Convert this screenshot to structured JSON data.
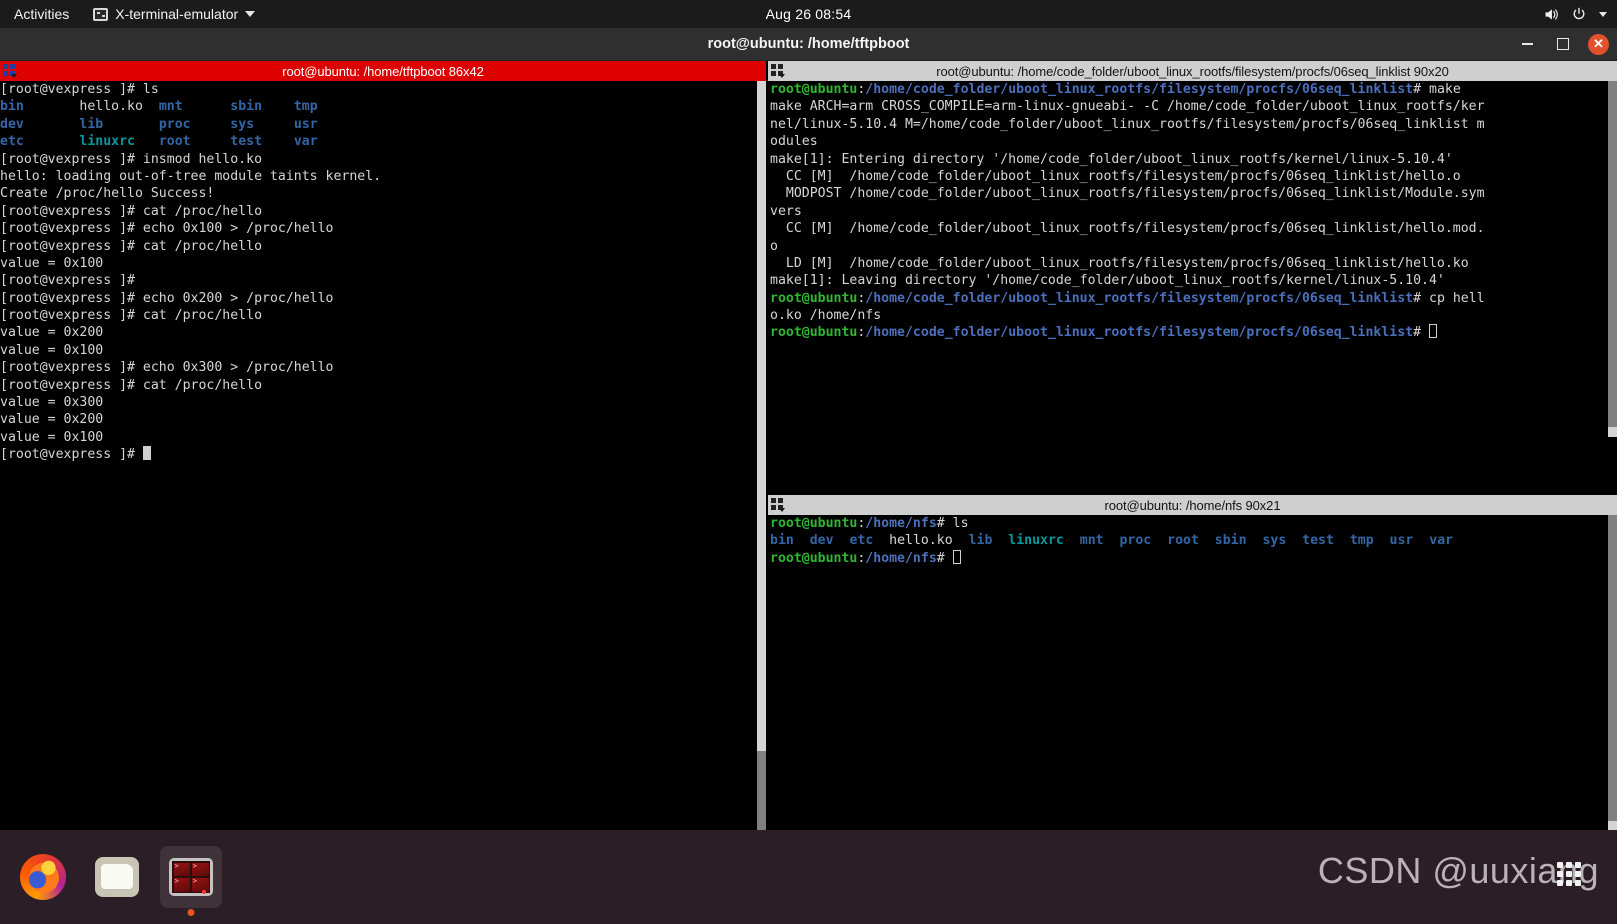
{
  "topbar": {
    "activities": "Activities",
    "app_menu": "X-terminal-emulator",
    "clock": "Aug 26  08:54",
    "icons": {
      "app": "terminal-icon",
      "caret": "chevron-down-icon",
      "volume": "volume-icon",
      "power": "power-icon",
      "arrow": "chevron-down-icon"
    }
  },
  "window": {
    "title": "root@ubuntu: /home/tftpboot",
    "minimize_label": "–",
    "maximize_label": "▢",
    "close_label": "✕"
  },
  "panes": {
    "left": {
      "title": "root@ubuntu: /home/tftpboot 86x42",
      "active": true,
      "lines": [
        [
          {
            "t": "[root@vexpress ]# ls",
            "c": "c-white"
          }
        ],
        [
          {
            "t": "bin",
            "c": "c-blue"
          },
          {
            "t": "       ",
            "c": "c-white"
          },
          {
            "t": "hello.ko",
            "c": "c-white"
          },
          {
            "t": "  ",
            "c": "c-white"
          },
          {
            "t": "mnt",
            "c": "c-blue"
          },
          {
            "t": "      ",
            "c": "c-white"
          },
          {
            "t": "sbin",
            "c": "c-blue"
          },
          {
            "t": "    ",
            "c": "c-white"
          },
          {
            "t": "tmp",
            "c": "c-blue"
          }
        ],
        [
          {
            "t": "dev",
            "c": "c-blue"
          },
          {
            "t": "       ",
            "c": "c-white"
          },
          {
            "t": "lib",
            "c": "c-blue"
          },
          {
            "t": "       ",
            "c": "c-white"
          },
          {
            "t": "proc",
            "c": "c-blue"
          },
          {
            "t": "     ",
            "c": "c-white"
          },
          {
            "t": "sys",
            "c": "c-blue"
          },
          {
            "t": "     ",
            "c": "c-white"
          },
          {
            "t": "usr",
            "c": "c-blue"
          }
        ],
        [
          {
            "t": "etc",
            "c": "c-blue"
          },
          {
            "t": "       ",
            "c": "c-white"
          },
          {
            "t": "linuxrc",
            "c": "c-cyan"
          },
          {
            "t": "   ",
            "c": "c-white"
          },
          {
            "t": "root",
            "c": "c-blue"
          },
          {
            "t": "     ",
            "c": "c-white"
          },
          {
            "t": "test",
            "c": "c-blue"
          },
          {
            "t": "    ",
            "c": "c-white"
          },
          {
            "t": "var",
            "c": "c-blue"
          }
        ],
        [
          {
            "t": "[root@vexpress ]# insmod hello.ko",
            "c": "c-white"
          }
        ],
        [
          {
            "t": "hello: loading out-of-tree module taints kernel.",
            "c": "c-white"
          }
        ],
        [
          {
            "t": "Create /proc/hello Success!",
            "c": "c-white"
          }
        ],
        [
          {
            "t": "[root@vexpress ]# cat /proc/hello",
            "c": "c-white"
          }
        ],
        [
          {
            "t": "[root@vexpress ]# echo 0x100 > /proc/hello",
            "c": "c-white"
          }
        ],
        [
          {
            "t": "[root@vexpress ]# cat /proc/hello",
            "c": "c-white"
          }
        ],
        [
          {
            "t": "value = 0x100",
            "c": "c-white"
          }
        ],
        [
          {
            "t": "[root@vexpress ]#",
            "c": "c-white"
          }
        ],
        [
          {
            "t": "[root@vexpress ]# echo 0x200 > /proc/hello",
            "c": "c-white"
          }
        ],
        [
          {
            "t": "[root@vexpress ]# cat /proc/hello",
            "c": "c-white"
          }
        ],
        [
          {
            "t": "value = 0x200",
            "c": "c-white"
          }
        ],
        [
          {
            "t": "value = 0x100",
            "c": "c-white"
          }
        ],
        [
          {
            "t": "[root@vexpress ]# echo 0x300 > /proc/hello",
            "c": "c-white"
          }
        ],
        [
          {
            "t": "[root@vexpress ]# cat /proc/hello",
            "c": "c-white"
          }
        ],
        [
          {
            "t": "value = 0x300",
            "c": "c-white"
          }
        ],
        [
          {
            "t": "value = 0x200",
            "c": "c-white"
          }
        ],
        [
          {
            "t": "value = 0x100",
            "c": "c-white"
          }
        ],
        [
          {
            "t": "[root@vexpress ]# ",
            "c": "c-white",
            "cursor": "block"
          }
        ]
      ]
    },
    "right_top": {
      "title": "root@ubuntu: /home/code_folder/uboot_linux_rootfs/filesystem/procfs/06seq_linklist 90x20",
      "active": false,
      "lines": [
        [
          {
            "t": "root@ubuntu",
            "c": "c-green"
          },
          {
            "t": ":",
            "c": "c-white"
          },
          {
            "t": "/home/code_folder/uboot_linux_rootfs/filesystem/procfs/06seq_linklist",
            "c": "c-blue2"
          },
          {
            "t": "# make",
            "c": "c-white"
          }
        ],
        [
          {
            "t": "make ARCH=arm CROSS_COMPILE=arm-linux-gnueabi- -C /home/code_folder/uboot_linux_rootfs/ker",
            "c": "c-white"
          }
        ],
        [
          {
            "t": "nel/linux-5.10.4 M=/home/code_folder/uboot_linux_rootfs/filesystem/procfs/06seq_linklist m",
            "c": "c-white"
          }
        ],
        [
          {
            "t": "odules",
            "c": "c-white"
          }
        ],
        [
          {
            "t": "make[1]: Entering directory '/home/code_folder/uboot_linux_rootfs/kernel/linux-5.10.4'",
            "c": "c-white"
          }
        ],
        [
          {
            "t": "  CC [M]  /home/code_folder/uboot_linux_rootfs/filesystem/procfs/06seq_linklist/hello.o",
            "c": "c-white"
          }
        ],
        [
          {
            "t": "  MODPOST /home/code_folder/uboot_linux_rootfs/filesystem/procfs/06seq_linklist/Module.sym",
            "c": "c-white"
          }
        ],
        [
          {
            "t": "vers",
            "c": "c-white"
          }
        ],
        [
          {
            "t": "  CC [M]  /home/code_folder/uboot_linux_rootfs/filesystem/procfs/06seq_linklist/hello.mod.",
            "c": "c-white"
          }
        ],
        [
          {
            "t": "o",
            "c": "c-white"
          }
        ],
        [
          {
            "t": "  LD [M]  /home/code_folder/uboot_linux_rootfs/filesystem/procfs/06seq_linklist/hello.ko",
            "c": "c-white"
          }
        ],
        [
          {
            "t": "make[1]: Leaving directory '/home/code_folder/uboot_linux_rootfs/kernel/linux-5.10.4'",
            "c": "c-white"
          }
        ],
        [
          {
            "t": "root@ubuntu",
            "c": "c-green"
          },
          {
            "t": ":",
            "c": "c-white"
          },
          {
            "t": "/home/code_folder/uboot_linux_rootfs/filesystem/procfs/06seq_linklist",
            "c": "c-blue2"
          },
          {
            "t": "# cp hell",
            "c": "c-white"
          }
        ],
        [
          {
            "t": "o.ko /home/nfs",
            "c": "c-white"
          }
        ],
        [
          {
            "t": "root@ubuntu",
            "c": "c-green"
          },
          {
            "t": ":",
            "c": "c-white"
          },
          {
            "t": "/home/code_folder/uboot_linux_rootfs/filesystem/procfs/06seq_linklist",
            "c": "c-blue2"
          },
          {
            "t": "# ",
            "c": "c-white",
            "cursor": "hollow"
          }
        ]
      ]
    },
    "right_bottom": {
      "title": "root@ubuntu: /home/nfs 90x21",
      "active": false,
      "lines": [
        [
          {
            "t": "root@ubuntu",
            "c": "c-green"
          },
          {
            "t": ":",
            "c": "c-white"
          },
          {
            "t": "/home/nfs",
            "c": "c-blue2"
          },
          {
            "t": "# ls",
            "c": "c-white"
          }
        ],
        [
          {
            "t": "bin",
            "c": "c-blue"
          },
          {
            "t": "  ",
            "c": "c-white"
          },
          {
            "t": "dev",
            "c": "c-blue"
          },
          {
            "t": "  ",
            "c": "c-white"
          },
          {
            "t": "etc",
            "c": "c-blue"
          },
          {
            "t": "  ",
            "c": "c-white"
          },
          {
            "t": "hello.ko",
            "c": "c-white"
          },
          {
            "t": "  ",
            "c": "c-white"
          },
          {
            "t": "lib",
            "c": "c-blue"
          },
          {
            "t": "  ",
            "c": "c-white"
          },
          {
            "t": "linuxrc",
            "c": "c-cyan"
          },
          {
            "t": "  ",
            "c": "c-white"
          },
          {
            "t": "mnt",
            "c": "c-blue"
          },
          {
            "t": "  ",
            "c": "c-white"
          },
          {
            "t": "proc",
            "c": "c-blue"
          },
          {
            "t": "  ",
            "c": "c-white"
          },
          {
            "t": "root",
            "c": "c-blue"
          },
          {
            "t": "  ",
            "c": "c-white"
          },
          {
            "t": "sbin",
            "c": "c-blue"
          },
          {
            "t": "  ",
            "c": "c-white"
          },
          {
            "t": "sys",
            "c": "c-blue"
          },
          {
            "t": "  ",
            "c": "c-white"
          },
          {
            "t": "test",
            "c": "c-blue"
          },
          {
            "t": "  ",
            "c": "c-white"
          },
          {
            "t": "tmp",
            "c": "c-blue"
          },
          {
            "t": "  ",
            "c": "c-white"
          },
          {
            "t": "usr",
            "c": "c-blue"
          },
          {
            "t": "  ",
            "c": "c-white"
          },
          {
            "t": "var",
            "c": "c-blue"
          }
        ],
        [
          {
            "t": "root@ubuntu",
            "c": "c-green"
          },
          {
            "t": ":",
            "c": "c-white"
          },
          {
            "t": "/home/nfs",
            "c": "c-blue2"
          },
          {
            "t": "# ",
            "c": "c-white",
            "cursor": "hollow"
          }
        ]
      ]
    }
  },
  "dock": {
    "items": [
      {
        "name": "firefox",
        "label": "Firefox",
        "running": false
      },
      {
        "name": "files",
        "label": "Files",
        "running": false
      },
      {
        "name": "terminal",
        "label": "X-terminal-emulator",
        "running": true
      }
    ]
  },
  "watermark": {
    "text": "CSDN @uuxiang"
  },
  "colors": {
    "active_pane_title": "#dc0000",
    "inactive_pane_title": "#cfcfcf",
    "terminal_bg": "#000000",
    "prompt_green": "#2fb82f",
    "path_blue": "#4b6fbd",
    "dir_blue": "#3465a4",
    "link_cyan": "#06989a",
    "accent_orange": "#e95420"
  }
}
